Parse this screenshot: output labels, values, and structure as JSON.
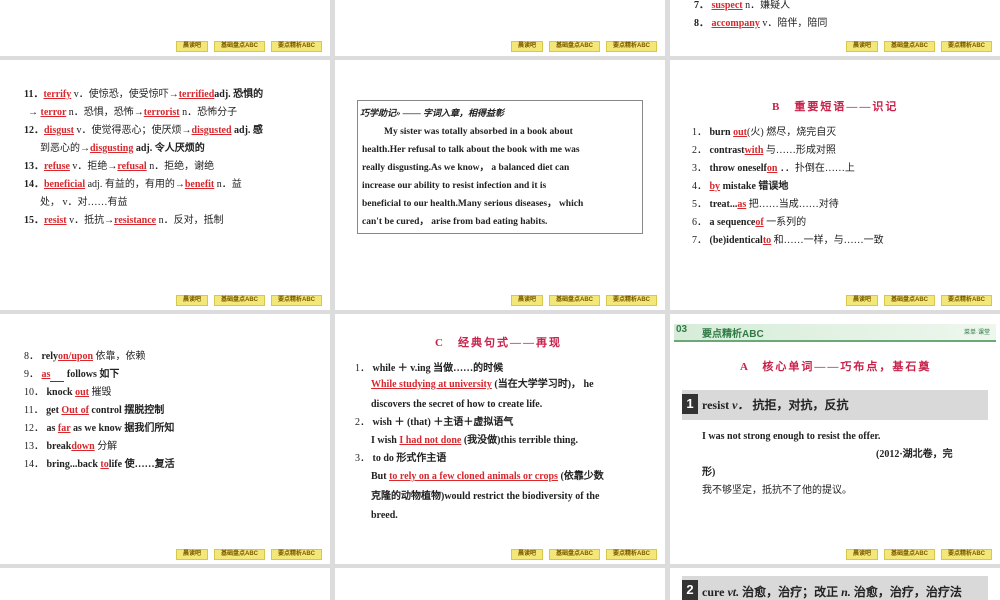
{
  "nav": {
    "b1": "晨读吧",
    "b2": "基础盘点ABC",
    "b3": "要点精析ABC"
  },
  "slide_top_right": {
    "l7": {
      "num": "7．",
      "ans": "suspect",
      "rest": "n．嫌疑人"
    },
    "l8": {
      "num": "8．",
      "ans": "accompany",
      "rest": "v．陪伴，陪同"
    }
  },
  "slide_words": {
    "lines": [
      {
        "num": "11．",
        "a1": "terrify",
        "t1": "v．使惊恐，使受惊吓→",
        "a2": "terrified",
        "t2": "adj. 恐惧的"
      },
      {
        "num": "→",
        "a1": "terror",
        "t1": "n．恐惧，恐怖→",
        "a2": "terrorist",
        "t2": "n．恐怖分子"
      },
      {
        "num": "12．",
        "a1": "disgust",
        "t1": "v．使觉得恶心；使厌烦→",
        "a2": "disgusted",
        "t2": "adj. 感"
      },
      {
        "num": "到恶心的→",
        "a1": "disgusting",
        "t1": "adj. 令人厌烦的",
        "a2": "",
        "t2": ""
      },
      {
        "num": "13．",
        "a1": "refuse",
        "t1": "v．拒绝→",
        "a2": "refusal",
        "t2": "n．拒绝，谢绝"
      },
      {
        "num": "14．",
        "a1": "beneficial",
        "t1": "adj. 有益的，有用的→",
        "a2": "benefit",
        "t2": "n．益"
      },
      {
        "num": "处， v．对……有益",
        "a1": "",
        "t1": "",
        "a2": "",
        "t2": ""
      },
      {
        "num": "15．",
        "a1": "resist",
        "t1": "v．抵抗→",
        "a2": "resistance",
        "t2": "n．反对，抵制"
      }
    ]
  },
  "slide_memory": {
    "title": "巧学助记»",
    "subtitle": "—— 字词入章，相得益彰",
    "lines": [
      "My sister was totally absorbed in a book about",
      "health.Her refusal to talk about the book with me was",
      "really disgusting.As we know， a balanced diet can",
      "increase our ability to resist infection and it is",
      "beneficial to our health.Many serious diseases， which",
      "can't be cured， arise from bad eating habits."
    ]
  },
  "slide_phrases": {
    "heading": "B　重要短语——识记",
    "lines": [
      {
        "num": "1．",
        "pre": "burn",
        "ans": "out",
        "post": "(火) 燃尽，烧完自灭"
      },
      {
        "num": "2．",
        "pre": "contrast",
        "ans": "with",
        "post": "与……形成对照"
      },
      {
        "num": "3．",
        "pre": "throw oneself",
        "ans": "on",
        "post": "．．扑倒在……上"
      },
      {
        "num": "4．",
        "pre": "",
        "ans": "by",
        "post": "mistake 错误地"
      },
      {
        "num": "5．",
        "pre": "treat...",
        "ans": "as",
        "post": "把……当成……对待"
      },
      {
        "num": "6．",
        "pre": "a sequence",
        "ans": "of",
        "post": "一系列的"
      },
      {
        "num": "7．",
        "pre": "(be)identical",
        "ans": "to",
        "post": "和……一样，与……一致"
      }
    ]
  },
  "slide_phrases2": {
    "lines": [
      {
        "num": "8．",
        "pre": "rely",
        "ans": "on/upon",
        "post": "依靠，依赖"
      },
      {
        "num": "9．",
        "pre": "",
        "ans": "as",
        "post": "follows 如下"
      },
      {
        "num": "10．",
        "pre": "knock",
        "ans": "out",
        "post": "摧毁"
      },
      {
        "num": "11．",
        "pre": "get",
        "ans": "Out of",
        "post": "control 摆脱控制"
      },
      {
        "num": "12．",
        "pre": "as",
        "ans": "far",
        "post": "as we know 据我们所知"
      },
      {
        "num": "13．",
        "pre": "break",
        "ans": "down",
        "post": "分解"
      },
      {
        "num": "14．",
        "pre": "bring...back",
        "ans": "to",
        "post": "life 使……复活"
      }
    ]
  },
  "slide_sentences": {
    "heading": "C　经典句式——再现",
    "s1_num": "1．",
    "s1_rule": "while ＋ v.ing 当做……的时候",
    "s1_ans": "While studying at university",
    "s1_cn": "(当在大学学习时)，",
    "s1_he": "he",
    "s1_line2": "discovers the secret of how to create life.",
    "s2_num": "2．",
    "s2_rule": "wish ＋ (that) ＋主语＋虚拟语气",
    "s2_pre": "I wish",
    "s2_ans": "I had not done",
    "s2_post": "(我没做)this terrible thing.",
    "s3_num": "3．",
    "s3_rule": "to do 形式作主语",
    "s3_pre": "But",
    "s3_ans": "to rely on a few cloned animals or crops",
    "s3_post": "(依靠少数",
    "s3_line2": "克隆的动物植物)would restrict the biodiversity of the",
    "s3_line3": "breed."
  },
  "slide_key": {
    "tag": "03",
    "header": "要点精析ABC",
    "header_right": "菜单·课堂",
    "heading": "A　核心单词——巧布点，基石奠",
    "item_num": "1",
    "item_word": "resist",
    "item_pos": "v．",
    "item_cn": "抗拒，对抗，反抗",
    "ex_en": "I was not strong enough to resist the offer.",
    "ex_src": "(2012·湖北卷，完",
    "ex_src2": "形)",
    "ex_cn": "我不够坚定，抵抗不了他的提议。"
  },
  "slide_bottom_right": {
    "item_num": "2",
    "item_word": "cure",
    "item_pos": "vt.",
    "item_cn": "治愈，治疗；改正",
    "item_pos2": "n.",
    "item_cn2": "治愈，治疗，治疗法"
  }
}
